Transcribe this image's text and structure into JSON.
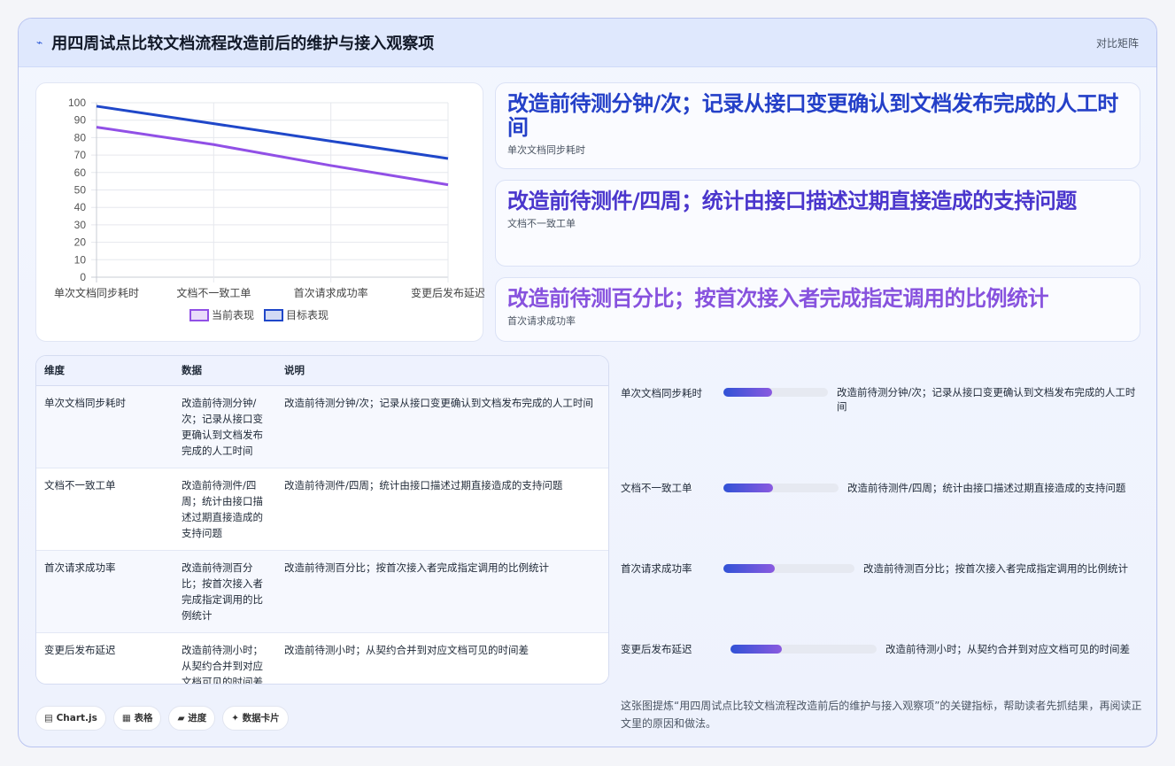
{
  "header": {
    "logo_icon": "⌁",
    "title": "用四周试点比较文档流程改造前后的维护与接入观察项",
    "tag": "对比矩阵"
  },
  "chart_data": {
    "type": "line",
    "categories": [
      "单次文档同步耗时",
      "文档不一致工单",
      "首次请求成功率",
      "变更后发布延迟"
    ],
    "series": [
      {
        "name": "当前表现",
        "values": [
          86,
          76,
          64,
          53
        ],
        "color": "#9150e6"
      },
      {
        "name": "目标表现",
        "values": [
          98,
          88,
          78,
          68
        ],
        "color": "#1f47c9"
      }
    ],
    "ylim": [
      0,
      100
    ],
    "yticks": [
      0,
      10,
      20,
      30,
      40,
      50,
      60,
      70,
      80,
      90,
      100
    ],
    "grid": true,
    "legend": "bottom"
  },
  "kpis": [
    {
      "big": "改造前待测分钟/次；记录从接口变更确认到文档发布完成的人工时间",
      "small": "单次文档同步耗时",
      "color": "#2440c8"
    },
    {
      "big": "改造前待测件/四周；统计由接口描述过期直接造成的支持问题",
      "small": "文档不一致工单",
      "color": "#4a36cc"
    },
    {
      "big": "改造前待测百分比；按首次接入者完成指定调用的比例统计",
      "small": "首次请求成功率",
      "color": "#8752de"
    }
  ],
  "table": {
    "headers": [
      "维度",
      "数据",
      "说明"
    ],
    "rows": [
      [
        "单次文档同步耗时",
        "改造前待测分钟/次；记录从接口变更确认到文档发布完成的人工时间",
        "改造前待测分钟/次；记录从接口变更确认到文档发布完成的人工时间"
      ],
      [
        "文档不一致工单",
        "改造前待测件/四周；统计由接口描述过期直接造成的支持问题",
        "改造前待测件/四周；统计由接口描述过期直接造成的支持问题"
      ],
      [
        "首次请求成功率",
        "改造前待测百分比；按首次接入者完成指定调用的比例统计",
        "改造前待测百分比；按首次接入者完成指定调用的比例统计"
      ],
      [
        "变更后发布延迟",
        "改造前待测小时；从契约合并到对应文档可见的时间差",
        "改造前待测小时；从契约合并到对应文档可见的时间差"
      ]
    ]
  },
  "progress": [
    {
      "label": "单次文档同步耗时",
      "value": 0.47,
      "text": "改造前待测分钟/次；记录从接口变更确认到文档发布完成的人工时间"
    },
    {
      "label": "文档不一致工单",
      "value": 0.43,
      "text": "改造前待测件/四周；统计由接口描述过期直接造成的支持问题"
    },
    {
      "label": "首次请求成功率",
      "value": 0.39,
      "text": "改造前待测百分比；按首次接入者完成指定调用的比例统计"
    },
    {
      "label": "变更后发布延迟",
      "value": 0.35,
      "text": "改造前待测小时；从契约合并到对应文档可见的时间差"
    }
  ],
  "chips": [
    {
      "icon": "chart-icon",
      "glyph": "▤",
      "label": "Chart.js"
    },
    {
      "icon": "table-icon",
      "glyph": "▦",
      "label": "表格"
    },
    {
      "icon": "progress-icon",
      "glyph": "▰",
      "label": "进度"
    },
    {
      "icon": "spark-icon",
      "glyph": "✦",
      "label": "数据卡片"
    }
  ],
  "footer": "这张图提炼“用四周试点比较文档流程改造前后的维护与接入观察项”的关键指标，帮助读者先抓结果，再阅读正文里的原因和做法。"
}
